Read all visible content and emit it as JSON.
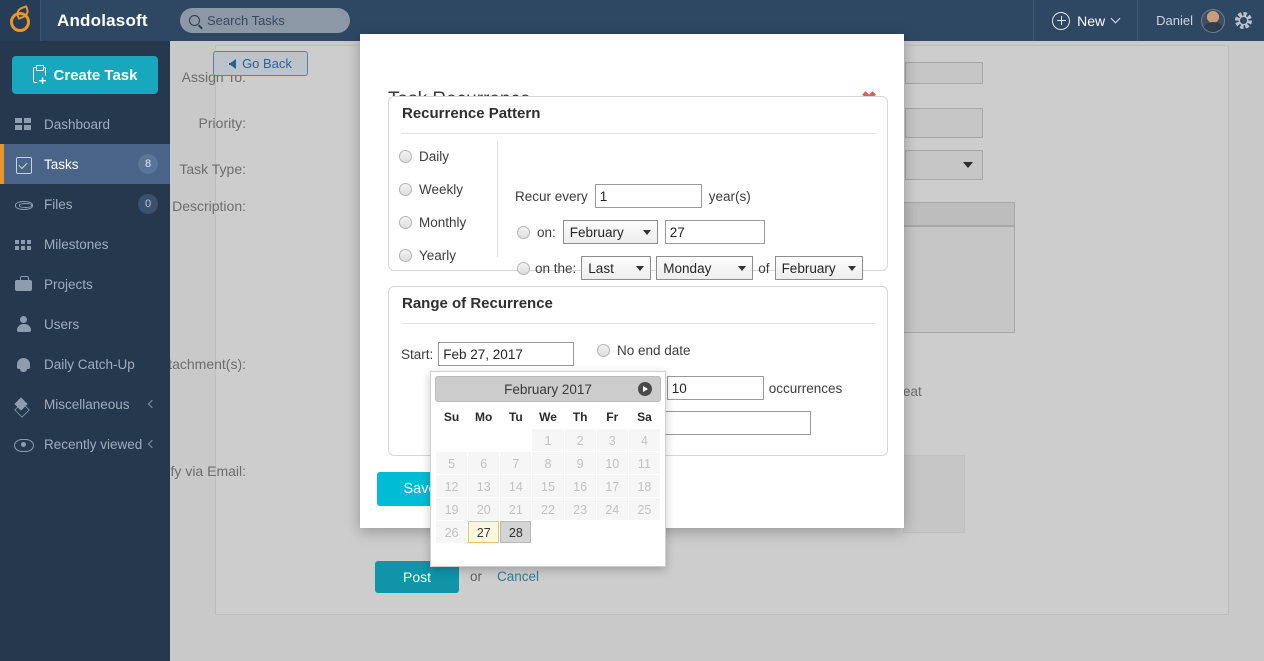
{
  "header": {
    "brand": "Andolasoft",
    "logo_icon": "apple-ring-logo",
    "search": {
      "placeholder": "Search Tasks",
      "value": "",
      "icon": "search-icon"
    },
    "new_button": {
      "label": "New",
      "icon": "plus-circle-icon",
      "caret_icon": "chevron-down-icon"
    },
    "user": {
      "name": "Daniel",
      "avatar_icon": "user-avatar"
    },
    "settings_icon": "gear-icon",
    "bg_color": "#2e4864"
  },
  "sidebar": {
    "create_task": {
      "label": "Create Task",
      "icon": "clipboard-plus-icon",
      "color": "#17a8bd"
    },
    "bg_color": "#26384e",
    "active_color": "#4a6489",
    "accent_color": "#e8952a",
    "items": [
      {
        "label": "Dashboard",
        "icon": "dashboard-icon",
        "badge": "",
        "caret": false,
        "active": false
      },
      {
        "label": "Tasks",
        "icon": "tasks-icon",
        "badge": "8",
        "caret": false,
        "active": true
      },
      {
        "label": "Files",
        "icon": "files-icon",
        "badge": "0",
        "caret": false,
        "active": false
      },
      {
        "label": "Milestones",
        "icon": "milestones-icon",
        "badge": "",
        "caret": false,
        "active": false
      },
      {
        "label": "Projects",
        "icon": "projects-icon",
        "badge": "",
        "caret": false,
        "active": false
      },
      {
        "label": "Users",
        "icon": "users-icon",
        "badge": "",
        "caret": false,
        "active": false
      },
      {
        "label": "Daily Catch-Up",
        "icon": "bell-icon",
        "badge": "",
        "caret": false,
        "active": false
      },
      {
        "label": "Miscellaneous",
        "icon": "layers-icon",
        "badge": "",
        "caret": true,
        "active": false
      },
      {
        "label": "Recently viewed",
        "icon": "eye-icon",
        "badge": "",
        "caret": true,
        "active": false
      }
    ]
  },
  "page": {
    "go_back": {
      "label": "Go Back",
      "icon": "arrow-left-icon"
    },
    "labels": {
      "assign_to": "Assign To:",
      "priority": "Priority:",
      "task_type": "Task Type:",
      "description": "Description:",
      "attachments": "Attachment(s):",
      "notify_email": "Notify via Email:"
    },
    "repeat_text": "eat",
    "post_button": "Post",
    "or_text": "or",
    "cancel_link": "Cancel"
  },
  "modal": {
    "title": "Task Recurrence",
    "close_icon": "close-icon",
    "close_glyph": "✖",
    "save_button": "Save",
    "pattern": {
      "title": "Recurrence Pattern",
      "frequencies": [
        {
          "label": "Daily",
          "selected": false
        },
        {
          "label": "Weekly",
          "selected": false
        },
        {
          "label": "Monthly",
          "selected": false
        },
        {
          "label": "Yearly",
          "selected": false
        }
      ],
      "recur_every_label": "Recur every",
      "recur_every_value": "1",
      "recur_unit": "year(s)",
      "on_label": "on:",
      "on_month": "February",
      "on_day": "27",
      "on_the_label": "on the:",
      "on_the_ordinal": "Last",
      "on_the_weekday": "Monday",
      "on_the_of": "of",
      "on_the_month": "February"
    },
    "range": {
      "title": "Range of Recurrence",
      "start_label": "Start:",
      "start_value": "Feb 27, 2017",
      "no_end_date": "No end date",
      "end_after_label": ":",
      "end_after_value": "10",
      "occurrences_label": "occurrences",
      "end_by_value": ""
    }
  },
  "datepicker": {
    "month_title": "February 2017",
    "next_icon": "next-arrow-icon",
    "weekdays": [
      "Su",
      "Mo",
      "Tu",
      "We",
      "Th",
      "Fr",
      "Sa"
    ],
    "weeks": [
      [
        {
          "d": "",
          "s": "empty"
        },
        {
          "d": "",
          "s": "empty"
        },
        {
          "d": "",
          "s": "empty"
        },
        {
          "d": "1",
          "s": "disabled"
        },
        {
          "d": "2",
          "s": "disabled"
        },
        {
          "d": "3",
          "s": "disabled"
        },
        {
          "d": "4",
          "s": "disabled"
        }
      ],
      [
        {
          "d": "5",
          "s": "disabled"
        },
        {
          "d": "6",
          "s": "disabled"
        },
        {
          "d": "7",
          "s": "disabled"
        },
        {
          "d": "8",
          "s": "disabled"
        },
        {
          "d": "9",
          "s": "disabled"
        },
        {
          "d": "10",
          "s": "disabled"
        },
        {
          "d": "11",
          "s": "disabled"
        }
      ],
      [
        {
          "d": "12",
          "s": "disabled"
        },
        {
          "d": "13",
          "s": "disabled"
        },
        {
          "d": "14",
          "s": "disabled"
        },
        {
          "d": "15",
          "s": "disabled"
        },
        {
          "d": "16",
          "s": "disabled"
        },
        {
          "d": "17",
          "s": "disabled"
        },
        {
          "d": "18",
          "s": "disabled"
        }
      ],
      [
        {
          "d": "19",
          "s": "disabled"
        },
        {
          "d": "20",
          "s": "disabled"
        },
        {
          "d": "21",
          "s": "disabled"
        },
        {
          "d": "22",
          "s": "disabled"
        },
        {
          "d": "23",
          "s": "disabled"
        },
        {
          "d": "24",
          "s": "disabled"
        },
        {
          "d": "25",
          "s": "disabled"
        }
      ],
      [
        {
          "d": "26",
          "s": "disabled"
        },
        {
          "d": "27",
          "s": "today"
        },
        {
          "d": "28",
          "s": "hover"
        },
        {
          "d": "",
          "s": "empty"
        },
        {
          "d": "",
          "s": "empty"
        },
        {
          "d": "",
          "s": "empty"
        },
        {
          "d": "",
          "s": "empty"
        }
      ]
    ]
  }
}
